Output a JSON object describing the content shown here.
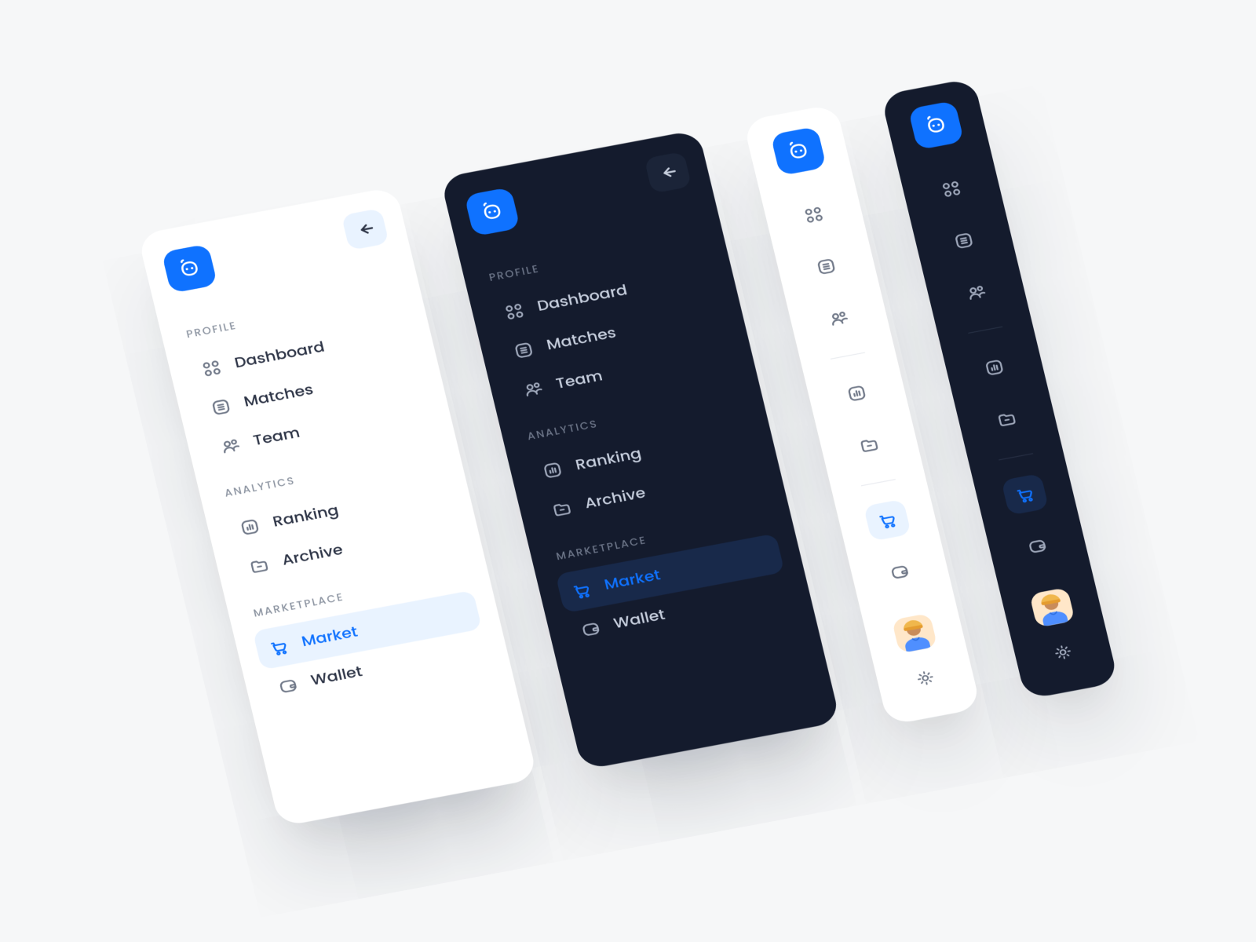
{
  "accent": "#0f72ff",
  "sections": {
    "profile": {
      "label": "PROFILE",
      "items": [
        {
          "key": "dashboard",
          "label": "Dashboard",
          "icon": "grid-icon"
        },
        {
          "key": "matches",
          "label": "Matches",
          "icon": "list-icon"
        },
        {
          "key": "team",
          "label": "Team",
          "icon": "users-icon"
        }
      ]
    },
    "analytics": {
      "label": "ANALYTICS",
      "items": [
        {
          "key": "ranking",
          "label": "Ranking",
          "icon": "chart-icon"
        },
        {
          "key": "archive",
          "label": "Archive",
          "icon": "folder-icon"
        }
      ]
    },
    "marketplace": {
      "label": "MARKETPLACE",
      "items": [
        {
          "key": "market",
          "label": "Market",
          "icon": "cart-icon",
          "active": true
        },
        {
          "key": "wallet",
          "label": "Wallet",
          "icon": "wallet-icon"
        }
      ]
    }
  }
}
